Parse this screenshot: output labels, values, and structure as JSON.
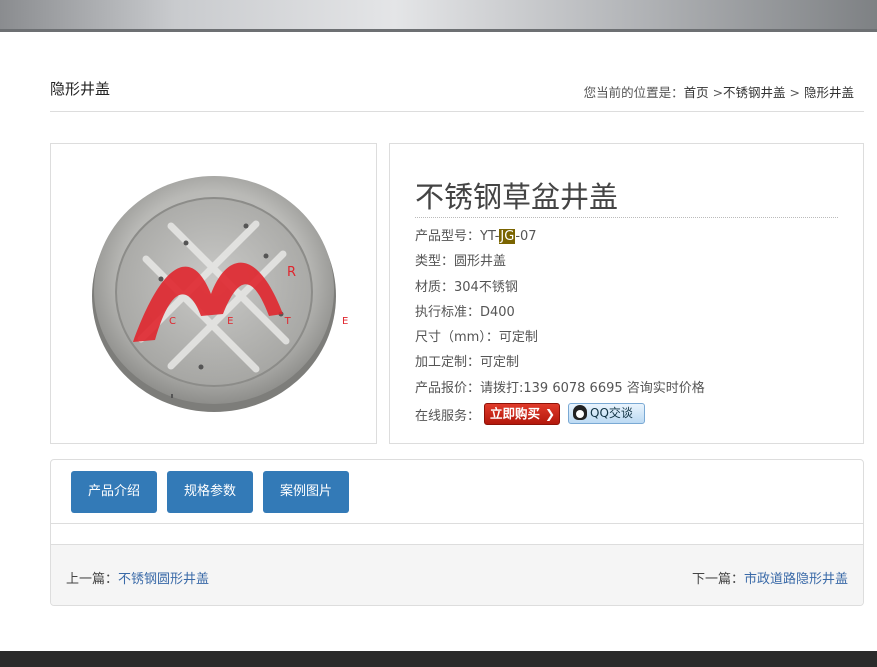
{
  "header": {
    "page_title": "隐形井盖",
    "breadcrumb_prefix": "您当前的位置是：",
    "breadcrumb": [
      "首页",
      "不锈钢井盖",
      "隐形井盖"
    ],
    "sep1": " >",
    "sep2": " > "
  },
  "image": {
    "logo_text": "C E T E",
    "logo_mark": "R"
  },
  "product": {
    "name": "不锈钢草盆井盖",
    "model_label": "产品型号：",
    "model_pre": "YT-",
    "model_hl": "JG",
    "model_post": "-07",
    "type": "类型：圆形井盖",
    "material": "材质：304不锈钢",
    "standard": "执行标准：D400",
    "size": "尺寸（mm）：可定制",
    "custom": "加工定制：可定制",
    "price": "产品报价：请拨打:139 6078 6695 咨询实时价格",
    "service_label": "在线服务：",
    "buy_label": "立即购买",
    "qq_label": "QQ交谈",
    "colors": {
      "buy": "#c0211a",
      "qq": "#bcdaf3",
      "highlight": "#7a6400"
    }
  },
  "tabs": [
    "产品介绍",
    "规格参数",
    "案例图片"
  ],
  "pager": {
    "prev_label": "上一篇：",
    "prev_link": "不锈钢圆形井盖",
    "next_label": "下一篇：",
    "next_link": "市政道路隐形井盖"
  },
  "colors": {
    "tab": "#337ab7",
    "link": "#3a6aa8",
    "footer": "#2b2b2b"
  }
}
